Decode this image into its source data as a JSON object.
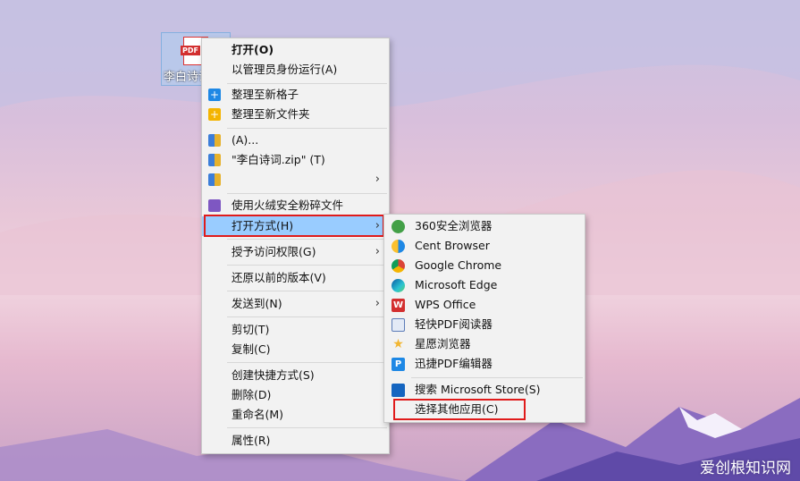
{
  "desktop_file": {
    "label": "李白诗词",
    "badge": "PDF"
  },
  "main_menu": {
    "items": [
      {
        "label": "打开(O)"
      },
      {
        "label": "以管理员身份运行(A)"
      },
      {
        "label": "整理至新格子"
      },
      {
        "label": "整理至新文件夹"
      },
      {
        "label": "(A)..."
      },
      {
        "label": " \"李白诗词.zip\" (T)"
      },
      {
        "label": ""
      },
      {
        "label": "使用火绒安全粉碎文件"
      },
      {
        "label": "打开方式(H)"
      },
      {
        "label": "授予访问权限(G)"
      },
      {
        "label": "还原以前的版本(V)"
      },
      {
        "label": "发送到(N)"
      },
      {
        "label": "剪切(T)"
      },
      {
        "label": "复制(C)"
      },
      {
        "label": "创建快捷方式(S)"
      },
      {
        "label": "删除(D)"
      },
      {
        "label": "重命名(M)"
      },
      {
        "label": "属性(R)"
      }
    ]
  },
  "submenu": {
    "items": [
      {
        "label": "360安全浏览器"
      },
      {
        "label": "Cent Browser"
      },
      {
        "label": "Google Chrome"
      },
      {
        "label": "Microsoft Edge"
      },
      {
        "label": "WPS Office"
      },
      {
        "label": "轻快PDF阅读器"
      },
      {
        "label": "星愿浏览器"
      },
      {
        "label": "迅捷PDF编辑器"
      },
      {
        "label": "搜索 Microsoft Store(S)"
      },
      {
        "label": "选择其他应用(C)"
      }
    ]
  },
  "watermark": "爱创根知识网",
  "colors": {
    "highlight": "#99ccff",
    "annotation_box": "#e01b1b"
  }
}
